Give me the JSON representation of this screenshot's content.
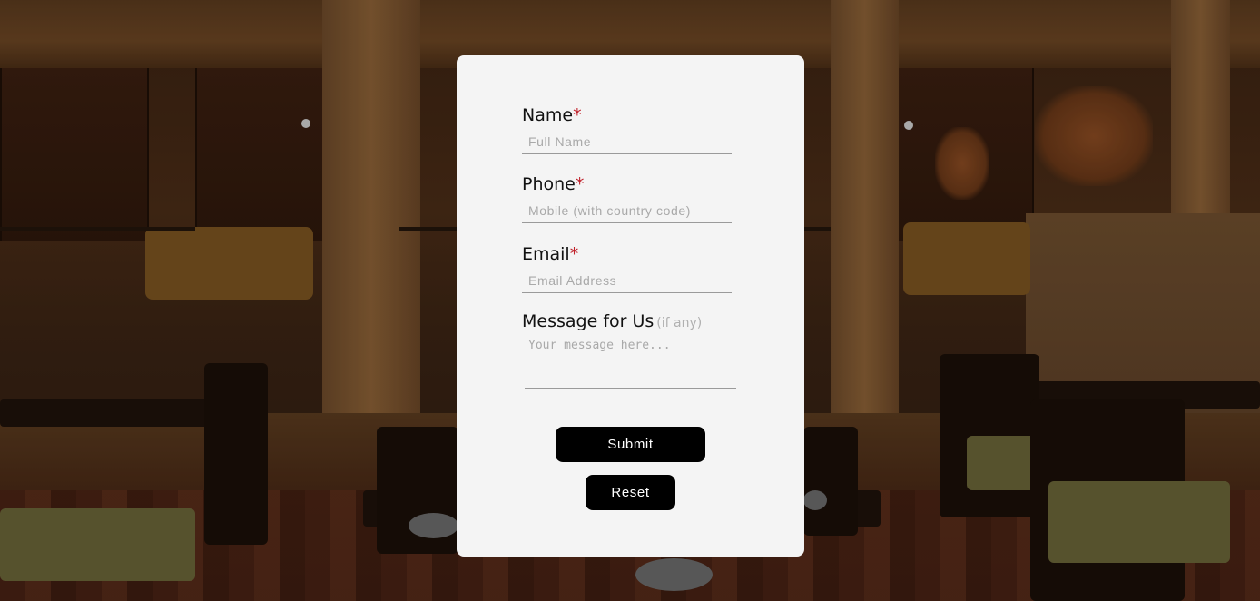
{
  "form": {
    "name": {
      "label": "Name",
      "required_mark": "*",
      "placeholder": "Full Name",
      "value": ""
    },
    "phone": {
      "label": "Phone",
      "required_mark": "*",
      "placeholder": "Mobile (with country code)",
      "value": ""
    },
    "email": {
      "label": "Email",
      "required_mark": "*",
      "placeholder": "Email Address",
      "value": ""
    },
    "message": {
      "label": "Message for Us",
      "hint": "(if any)",
      "placeholder": "Your message here...",
      "value": ""
    },
    "submit_label": "Submit",
    "reset_label": "Reset"
  },
  "colors": {
    "card_background": "#f4f4f4",
    "required_mark": "#c0202a",
    "button_background": "#000000",
    "button_text": "#ffffff"
  }
}
